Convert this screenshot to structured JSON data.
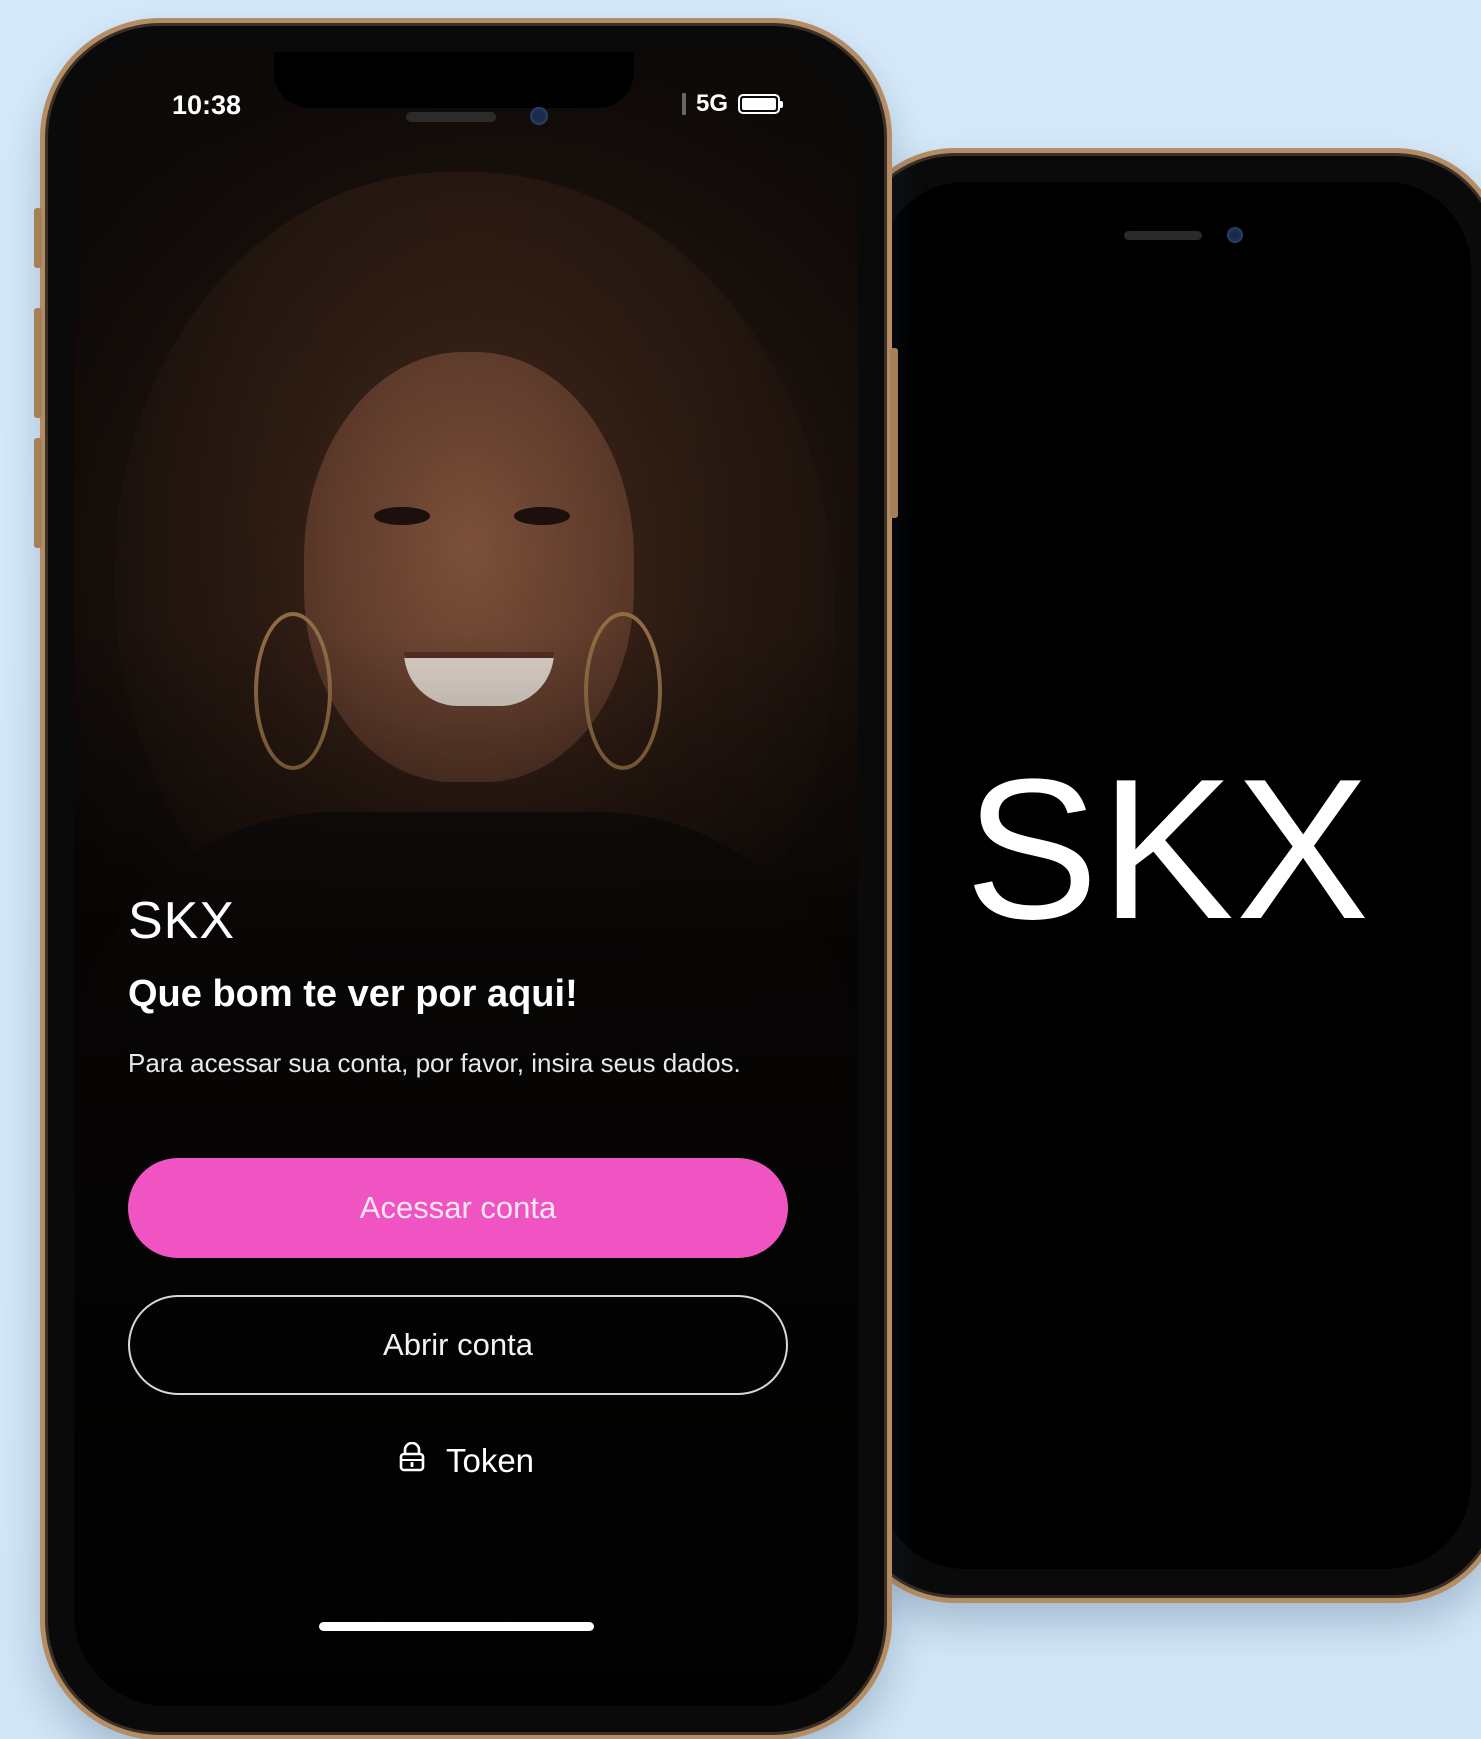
{
  "colors": {
    "background": "#d3e8f8",
    "frame_gold": "#b48d64",
    "primary_button": "#ef54c2",
    "screen_black": "#000000"
  },
  "back_phone": {
    "logo": "SKX"
  },
  "front_phone": {
    "status_bar": {
      "time": "10:38",
      "network": "5G",
      "battery_level": 1.0
    },
    "logo": "SKX",
    "headline": "Que bom te ver por aqui!",
    "subtext": "Para acessar sua conta, por favor, insira seus dados.",
    "primary_button_label": "Acessar conta",
    "secondary_button_label": "Abrir conta",
    "token_label": "Token",
    "token_icon": "lock-icon"
  }
}
